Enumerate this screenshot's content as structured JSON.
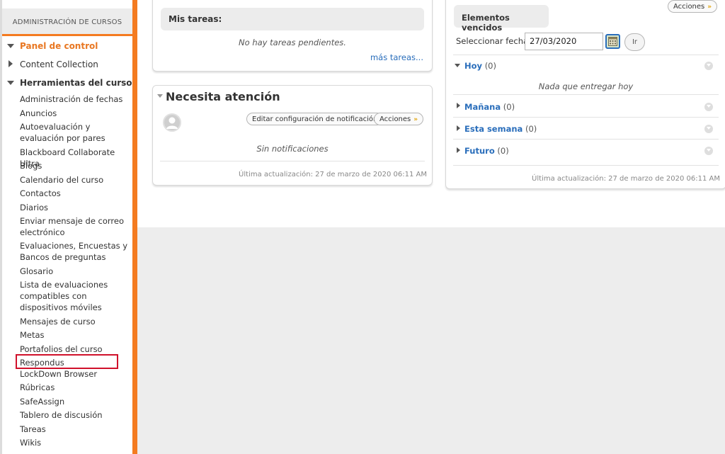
{
  "sidebar": {
    "header": "ADMINISTRACIÓN DE CURSOS",
    "panel_de_control": "Panel de control",
    "content_collection": "Content Collection",
    "herramientas": "Herramientas del curso",
    "tools": [
      "Administración de fechas",
      "Anuncios",
      "Autoevaluación y evaluación por pares",
      "Blackboard Collaborate Ultra",
      "Blogs",
      "Calendario del curso",
      "Contactos",
      "Diarios",
      "Enviar mensaje de correo electrónico",
      "Evaluaciones, Encuestas y Bancos de preguntas",
      "Glosario",
      "Lista de evaluaciones compatibles con dispositivos móviles",
      "Mensajes de curso",
      "Metas",
      "Portafolios del curso",
      "Respondus LockDown Browser",
      "Rúbricas",
      "SafeAssign",
      "Tablero de discusión",
      "Tareas",
      "Wikis"
    ]
  },
  "tareas": {
    "title": "Mis tareas:",
    "empty": "No hay tareas pendientes.",
    "more": "más tareas..."
  },
  "atencion": {
    "title": "Necesita atención",
    "edit_button": "Editar configuración de notificación",
    "actions_button": "Acciones",
    "empty": "Sin notificaciones",
    "updated": "Última actualización: 27 de marzo de 2020 06:11 AM"
  },
  "vencidos": {
    "actions_button": "Acciones",
    "title": "Elementos vencidos",
    "select_label": "Seleccionar fecha:",
    "date_value": "27/03/2020",
    "go_button": "Ir",
    "hoy_label": "Hoy",
    "hoy_count": "(0)",
    "hoy_empty": "Nada que entregar hoy",
    "manana_label": "Mañana",
    "manana_count": "(0)",
    "semana_label": "Esta semana",
    "semana_count": "(0)",
    "futuro_label": "Futuro",
    "futuro_count": "(0)",
    "updated": "Última actualización: 27 de marzo de 2020 06:11 AM"
  },
  "colors": {
    "accent": "#f47b20",
    "link": "#2a6ebb",
    "highlight": "#d0112b"
  }
}
